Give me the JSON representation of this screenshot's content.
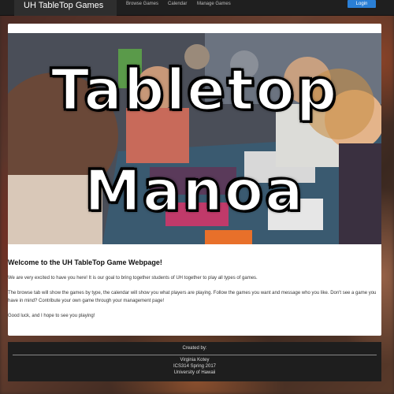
{
  "navbar": {
    "brand": "UH TableTop Games",
    "links": [
      "Browse Games",
      "Calendar",
      "Manage Games"
    ],
    "login_label": "Login"
  },
  "hero": {
    "title_line1": "Tabletop",
    "title_line2": "Manoa"
  },
  "content": {
    "welcome": "Welcome to the UH TableTop Game Webpage!",
    "paragraph1": "We are very excited to have you here! It is our goal to bring together students of UH together to play all types of games.",
    "paragraph2": "The browse tab will show the games by type, the calendar will show you what players are playing. Follow the games you want and message who you like. Don't see a game you have in mind? Contribute your own game through your management page!",
    "paragraph3": "Good luck, and I hope to see you playing!"
  },
  "footer": {
    "title": "Created by:",
    "line1": "Virginia Kotey",
    "line2": "ICS314 Spring 2017",
    "line3": "University of Hawaii"
  },
  "colors": {
    "navbar": "#1f1f1f",
    "login_button": "#2a7fd6",
    "footer": "#1e1e1e"
  }
}
